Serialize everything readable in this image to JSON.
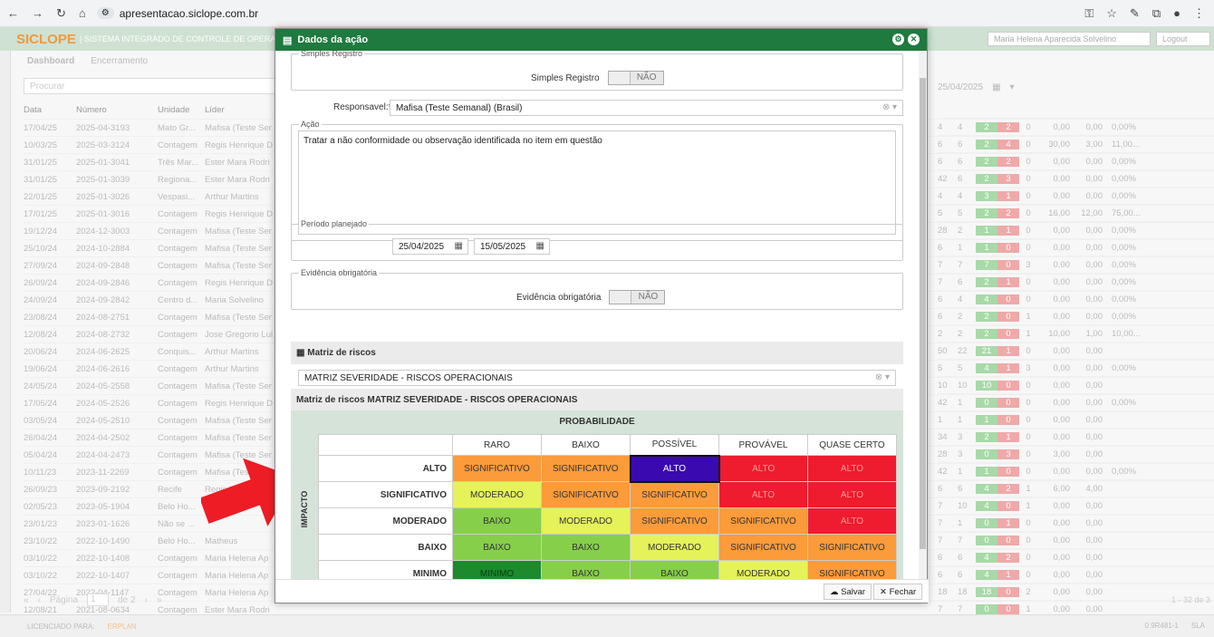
{
  "browser": {
    "url": "apresentacao.siclope.com.br"
  },
  "app": {
    "brand": "SICLOPE",
    "system": "| SISTEMA INTEGRADO DE CONTROLE DE OPERAÇÕES",
    "user": "Maria Helena Aparecida Solvelino",
    "logout": "Logout",
    "tabs": [
      "Dashboard",
      "Encerramento"
    ],
    "search_placeholder": "Procurar",
    "date": "25/04/2025"
  },
  "grid": {
    "headers": [
      "Data",
      "Número",
      "Unidade",
      "Líder"
    ],
    "rows": [
      [
        "17/04/25",
        "2025-04-3193",
        "Mato Gr...",
        "Mafisa (Teste Ser"
      ],
      [
        "10/03/25",
        "2025-03-3124",
        "Contagem",
        "Regis Henrique D"
      ],
      [
        "31/01/25",
        "2025-01-3041",
        "Três Mar...",
        "Ester Mara Rodri"
      ],
      [
        "31/01/25",
        "2025-01-3039",
        "Regiona...",
        "Ester Mara Rodri"
      ],
      [
        "22/01/25",
        "2025-01-3026",
        "Vespasi...",
        "Arthur Martins"
      ],
      [
        "17/01/25",
        "2025-01-3016",
        "Contagem",
        "Regis Henrique D"
      ],
      [
        "19/12/24",
        "2024-12-3003",
        "Contagem",
        "Mafisa (Teste Ser"
      ],
      [
        "25/10/24",
        "2024-10-2884",
        "Contagem",
        "Mafisa (Teste Ser"
      ],
      [
        "27/09/24",
        "2024-09-2848",
        "Contagem",
        "Mafisa (Teste Ser"
      ],
      [
        "26/09/24",
        "2024-09-2846",
        "Contagem",
        "Regis Henrique D"
      ],
      [
        "24/09/24",
        "2024-09-2842",
        "Centro d...",
        "Maria Solvelino"
      ],
      [
        "23/08/24",
        "2024-08-2751",
        "Contagem",
        "Mafisa (Teste Ser"
      ],
      [
        "12/08/24",
        "2024-08-2732",
        "Contagem",
        "Jose Gregorio Lul"
      ],
      [
        "20/06/24",
        "2024-06-2625",
        "Conquis...",
        "Arthur Martins"
      ],
      [
        "19/06/24",
        "2024-06-2616",
        "Contagem",
        "Arthur Martins"
      ],
      [
        "24/05/24",
        "2024-05-2558",
        "Contagem",
        "Mafisa (Teste Ser"
      ],
      [
        "17/05/24",
        "2024-05-2526",
        "Contagem",
        "Regis Henrique D"
      ],
      [
        "03/05/24",
        "2024-05-2510",
        "Contagem",
        "Mafisa (Teste Ser"
      ],
      [
        "26/04/24",
        "2024-04-2502",
        "Contagem",
        "Mafisa (Teste Ser"
      ],
      [
        "05/04/24",
        "2024-04-2473",
        "Contagem",
        "Mafisa (Teste Ser"
      ],
      [
        "10/11/23",
        "2023-11-2269",
        "Contagem",
        "Mafisa (Teste Ser"
      ],
      [
        "26/09/23",
        "2023-09-2192",
        "Recife",
        "Regis H..."
      ],
      [
        "02/05/23",
        "2023-05-1904",
        "Belo Ho...",
        "Matheus"
      ],
      [
        "23/01/23",
        "2023-01-1626",
        "Não se ...",
        ""
      ],
      [
        "23/10/22",
        "2022-10-1490",
        "Belo Ho...",
        "Matheus"
      ],
      [
        "03/10/22",
        "2022-10-1408",
        "Contagem",
        "Maria Helena Ap"
      ],
      [
        "03/10/22",
        "2022-10-1407",
        "Contagem",
        "Maria Helena Ap"
      ],
      [
        "27/04/22",
        "2022-04-1147",
        "Contagem",
        "Maria Helena Ap"
      ],
      [
        "12/08/21",
        "2021-08-0634",
        "Contagem",
        "Ester Mara Rodri"
      ]
    ]
  },
  "rgrid": {
    "rows": [
      [
        "4",
        "4",
        "2",
        "2",
        "0",
        "0,00",
        "0,00",
        "0,00%"
      ],
      [
        "6",
        "6",
        "2",
        "4",
        "0",
        "30,00",
        "3,00",
        "11,00..."
      ],
      [
        "6",
        "6",
        "2",
        "2",
        "0",
        "0,00",
        "0,00",
        "0,00%"
      ],
      [
        "42",
        "6",
        "2",
        "3",
        "0",
        "0,00",
        "0,00",
        "0,00%"
      ],
      [
        "4",
        "4",
        "3",
        "1",
        "0",
        "0,00",
        "0,00",
        "0,00%"
      ],
      [
        "5",
        "5",
        "2",
        "2",
        "0",
        "16,00",
        "12,00",
        "75,00..."
      ],
      [
        "28",
        "2",
        "1",
        "1",
        "0",
        "0,00",
        "0,00",
        "0,00%"
      ],
      [
        "6",
        "1",
        "1",
        "0",
        "0",
        "0,00",
        "0,00",
        "0,00%"
      ],
      [
        "7",
        "7",
        "7",
        "0",
        "3",
        "0,00",
        "0,00",
        "0,00%"
      ],
      [
        "7",
        "6",
        "2",
        "1",
        "0",
        "0,00",
        "0,00",
        "0,00%"
      ],
      [
        "6",
        "4",
        "4",
        "0",
        "0",
        "0,00",
        "0,00",
        "0,00%"
      ],
      [
        "6",
        "2",
        "2",
        "0",
        "1",
        "0,00",
        "0,00",
        "0,00%"
      ],
      [
        "2",
        "2",
        "2",
        "0",
        "1",
        "10,00",
        "1,00",
        "10,00..."
      ],
      [
        "50",
        "22",
        "21",
        "1",
        "0",
        "0,00",
        "0,00",
        ""
      ],
      [
        "5",
        "5",
        "4",
        "1",
        "3",
        "0,00",
        "0,00",
        "0,00%"
      ],
      [
        "10",
        "10",
        "10",
        "0",
        "0",
        "0,00",
        "0,00",
        ""
      ],
      [
        "42",
        "1",
        "0",
        "0",
        "0",
        "0,00",
        "0,00",
        "0,00%"
      ],
      [
        "1",
        "1",
        "1",
        "0",
        "0",
        "0,00",
        "0,00",
        ""
      ],
      [
        "34",
        "3",
        "2",
        "1",
        "0",
        "0,00",
        "0,00",
        ""
      ],
      [
        "28",
        "3",
        "0",
        "3",
        "0",
        "3,00",
        "0,00",
        ""
      ],
      [
        "42",
        "1",
        "1",
        "0",
        "0",
        "0,00",
        "0,00",
        "0,00%"
      ],
      [
        "6",
        "6",
        "4",
        "2",
        "1",
        "6,00",
        "4,00",
        ""
      ],
      [
        "7",
        "10",
        "4",
        "0",
        "1",
        "0,00",
        "0,00",
        ""
      ],
      [
        "7",
        "1",
        "0",
        "1",
        "0",
        "0,00",
        "0,00",
        ""
      ],
      [
        "7",
        "7",
        "0",
        "0",
        "0",
        "0,00",
        "0,00",
        ""
      ],
      [
        "6",
        "6",
        "4",
        "2",
        "0",
        "0,00",
        "0,00",
        ""
      ],
      [
        "6",
        "6",
        "4",
        "1",
        "0",
        "0,00",
        "0,00",
        ""
      ],
      [
        "18",
        "18",
        "18",
        "0",
        "2",
        "0,00",
        "0,00",
        ""
      ],
      [
        "7",
        "7",
        "0",
        "0",
        "1",
        "0,00",
        "0,00",
        ""
      ]
    ]
  },
  "pager": {
    "page_label": "Página",
    "page": "1",
    "of": "de 2",
    "count": "1 - 32 de 3"
  },
  "status": {
    "license": "LICENCIADO PARA:",
    "erplan": "ERPLAN",
    "version": "0.9R481-1",
    "sla": "SLA"
  },
  "modal": {
    "title": "Dados da ação",
    "simples_legend": "Simples Registro",
    "simples_label": "Simples Registro",
    "simples_value": "NÃO",
    "resp_label": "Responsavel:*",
    "resp_value": "Mafisa (Teste Semanal) (Brasil)",
    "acao_legend": "Ação",
    "acao_text": "Tratar a não conformidade ou observação identificada no item em questão",
    "periodo_legend": "Período planejado",
    "date_start": "25/04/2025",
    "date_end": "15/05/2025",
    "evid_legend": "Evidência obrigatória",
    "evid_label": "Evidência obrigatória",
    "evid_value": "NÃO",
    "matriz_header": "Matriz de riscos",
    "matriz_select": "MATRIZ SEVERIDADE - RISCOS OPERACIONAIS",
    "matriz_title": "Matriz de riscos MATRIZ SEVERIDADE - RISCOS OPERACIONAIS",
    "prob_label": "PROBABILIDADE",
    "impact_label": "IMPACTO",
    "cols": [
      "RARO",
      "BAIXO",
      "POSSÍVEL",
      "PROVÁVEL",
      "QUASE CERTO"
    ],
    "rows": [
      {
        "label": "ALTO",
        "cells": [
          "SIGNIFICATIVO",
          "SIGNIFICATIVO",
          "ALTO",
          "ALTO",
          "ALTO"
        ]
      },
      {
        "label": "SIGNIFICATIVO",
        "cells": [
          "MODERADO",
          "SIGNIFICATIVO",
          "SIGNIFICATIVO",
          "ALTO",
          "ALTO"
        ]
      },
      {
        "label": "MODERADO",
        "cells": [
          "BAIXO",
          "MODERADO",
          "SIGNIFICATIVO",
          "SIGNIFICATIVO",
          "ALTO"
        ]
      },
      {
        "label": "BAIXO",
        "cells": [
          "BAIXO",
          "BAIXO",
          "MODERADO",
          "SIGNIFICATIVO",
          "SIGNIFICATIVO"
        ]
      },
      {
        "label": "MINIMO",
        "cells": [
          "MINIMO",
          "BAIXO",
          "BAIXO",
          "MODERADO",
          "SIGNIFICATIVO"
        ]
      }
    ],
    "save": "Salvar",
    "close": "Fechar"
  }
}
